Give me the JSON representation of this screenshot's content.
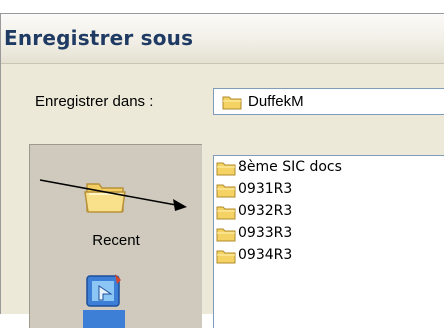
{
  "dialog": {
    "title": "Enregistrer sous",
    "save_in_label": "Enregistrer dans :",
    "save_in_value": "DuffekM",
    "places": [
      {
        "label": "Recent",
        "icon": "recent-folder-icon"
      },
      {
        "label": "",
        "icon": "desktop-icon"
      }
    ],
    "files": [
      {
        "name": "8ème SIC docs",
        "icon": "folder-icon"
      },
      {
        "name": "0931R3",
        "icon": "folder-icon"
      },
      {
        "name": "0932R3",
        "icon": "folder-icon"
      },
      {
        "name": "0933R3",
        "icon": "folder-icon"
      },
      {
        "name": "0934R3",
        "icon": "folder-icon"
      }
    ]
  },
  "colors": {
    "title_text": "#1f3b63",
    "dialog_bg": "#ece9d8",
    "places_bg": "#cfcabd",
    "folder_yellow": "#f5d264",
    "border_blue": "#7f9db9",
    "annotation_arrow": "#000000"
  }
}
